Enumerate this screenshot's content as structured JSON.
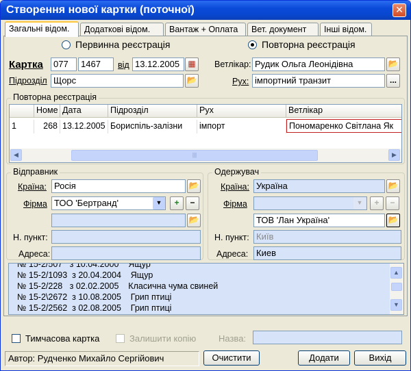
{
  "window": {
    "title": "Створення нової картки (поточної)",
    "close": "✕"
  },
  "tabs": [
    "Загальні відом.",
    "Додаткові відом.",
    "Вантаж + Оплата",
    "Вет. документ",
    "Інші відом."
  ],
  "registration": {
    "primary": "Первинна реєстрація",
    "repeat": "Повторна реєстрація"
  },
  "card": {
    "label": "Картка",
    "num1": "077",
    "num2": "1467",
    "from_label": "від",
    "date": "13.12.2005",
    "vet_label": "Ветлікар:",
    "vet_value": "Рудик Ольга Леонідівна",
    "dept_label": "Підрозділ",
    "dept_value": "Щорс",
    "move_label": "Рух:",
    "move_value": "імпортний транзит"
  },
  "repeat_group": {
    "title": "Повторна реєстрація",
    "columns": [
      "Номе",
      "Дата",
      "Підрозділ",
      "Рух",
      "Ветлікар"
    ],
    "rows": [
      [
        "1",
        "268",
        "13.12.2005",
        "Бориспіль-залізни",
        "імпорт",
        "Пономаренко Світлана Як"
      ]
    ],
    "scroll_grip": "|||"
  },
  "sender": {
    "title": "Відправник",
    "country_label": "Країна:",
    "country_value": "Росія",
    "firm_label": "Фірма",
    "firm_value": "ТОО 'Бертранд'",
    "place_label": "Н. пункт:",
    "place_value": "",
    "address_label": "Адреса:",
    "address_value": ""
  },
  "receiver": {
    "title": "Одержувач",
    "country_label": "Країна:",
    "country_value": "Україна",
    "firm_label": "Фірма",
    "firm_value": "",
    "firm_value2": "ТОВ 'Лан Україна'",
    "place_label": "Н. пункт:",
    "place_value": "Київ",
    "address_label": "Адреса:",
    "address_value": "Киев"
  },
  "memo_lines": [
    "№ 15-2/507   з 10.04.2000    Ящур",
    "№ 15-2/1093  з 20.04.2004    Ящур",
    "№ 15-2/228   з 02.02.2005    Класична чума свиней",
    "№ 15-2\\2672  з 10.08.2005    Грип птиці",
    "№ 15-2/2562  з 02.08.2005    Грип птиці"
  ],
  "footer": {
    "temp_card": "Тимчасова картка",
    "keep_copy": "Залишити копію",
    "name_label": "Назва:",
    "author": "Автор: Рудченко Михайло Сергійович",
    "clear": "Очистити",
    "add": "Додати",
    "exit": "Вихід"
  },
  "icons": {
    "folder": "📂",
    "calendar": "▦",
    "ellipsis": "...",
    "plus": "+",
    "minus": "−",
    "dropdown": "▼",
    "up": "▲",
    "down": "▼",
    "left": "◀",
    "right": "▶"
  }
}
